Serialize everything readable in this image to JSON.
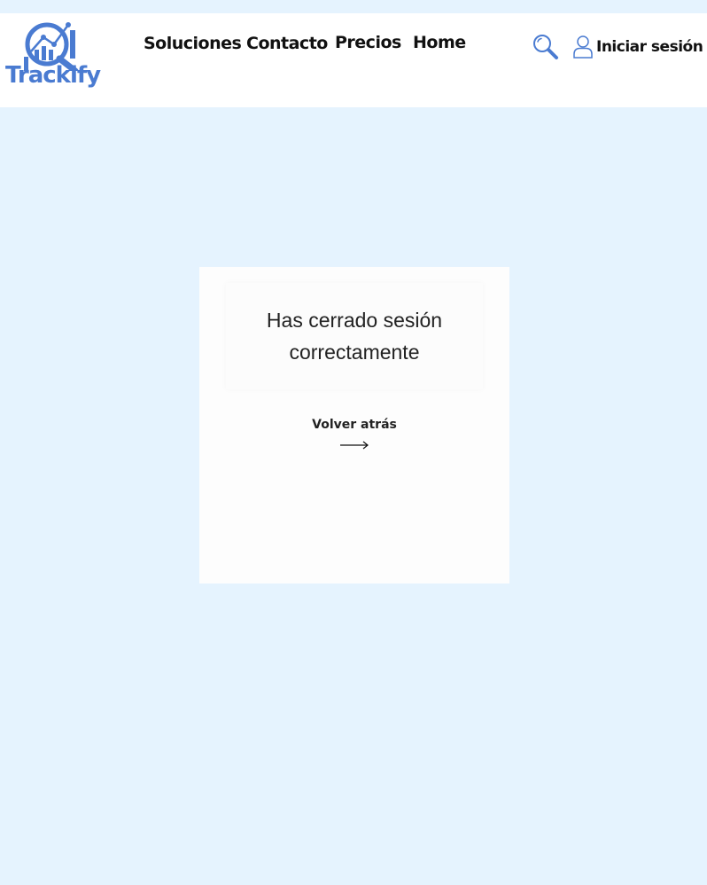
{
  "brand": {
    "name": "Trackify",
    "logo_color": "#4a7bd1"
  },
  "nav": {
    "items": [
      {
        "label": "Soluciones"
      },
      {
        "label": "Contacto"
      },
      {
        "label": "Precios"
      },
      {
        "label": "Home"
      }
    ]
  },
  "header": {
    "search_icon": "search-icon",
    "user_icon": "user-icon",
    "login_label": "Iniciar sesión"
  },
  "logout": {
    "message": "Has cerrado sesión correctamente",
    "back_label": "Volver atrás",
    "back_icon": "arrow-right-icon"
  },
  "colors": {
    "page_background": "#e5f3fe",
    "header_background": "#ffffff",
    "accent": "#4a7bd1"
  }
}
